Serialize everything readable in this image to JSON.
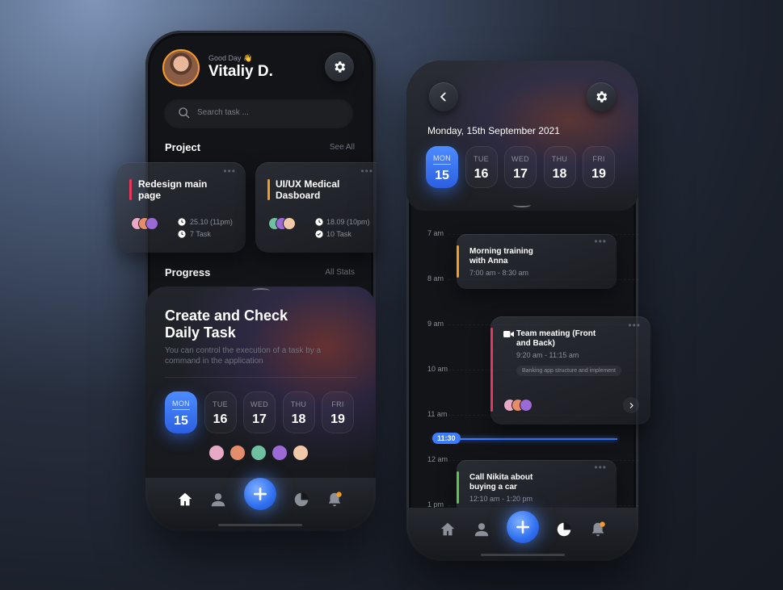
{
  "left_phone": {
    "greeting": "Good Day 👋",
    "user_name": "Vitaliy D.",
    "search_placeholder": "Search task ...",
    "project_title": "Project",
    "see_all": "See All",
    "projects": [
      {
        "title": "Redesign main page",
        "accent": "#e8365c",
        "date": "25.10 (11pm)",
        "tasks": "7 Task"
      },
      {
        "title": "UI/UX Medical Dasboard",
        "accent": "#f59a23",
        "date": "18.09 (10pm)",
        "tasks": "10 Task"
      }
    ],
    "progress_title": "Progress",
    "all_stats": "All Stats",
    "card_title": "Create and Check Daily Task",
    "card_desc": "You can control the execution of a task by a command in the application",
    "days": [
      {
        "name": "MON",
        "num": "15",
        "active": true
      },
      {
        "name": "TUE",
        "num": "16"
      },
      {
        "name": "WED",
        "num": "17"
      },
      {
        "name": "THU",
        "num": "18"
      },
      {
        "name": "FRI",
        "num": "19"
      }
    ]
  },
  "right_phone": {
    "date_title": "Monday, 15th September 2021",
    "days": [
      {
        "name": "MON",
        "num": "15",
        "active": true
      },
      {
        "name": "TUE",
        "num": "16"
      },
      {
        "name": "WED",
        "num": "17"
      },
      {
        "name": "THU",
        "num": "18"
      },
      {
        "name": "FRI",
        "num": "19"
      }
    ],
    "hours": [
      "7 am",
      "8 am",
      "9 am",
      "10 am",
      "11 am",
      "12 am",
      "1 pm"
    ],
    "now_time": "11:30",
    "events": [
      {
        "title": "Morning training with Anna",
        "time": "7:00 am - 8:30 am",
        "accent": "#f59a23"
      },
      {
        "title": "Team meating (Front and Back)",
        "time": "9:20 am - 11:15 am",
        "tag": "Banking app structure and implement",
        "accent": "#e8365c"
      },
      {
        "title": "Call Nikita about buying a car",
        "time": "12:10 am - 1:20 pm",
        "accent": "#57c84d"
      }
    ]
  },
  "colors": {
    "accent_blue": "#3d7bff",
    "notification": "#f59a23"
  }
}
